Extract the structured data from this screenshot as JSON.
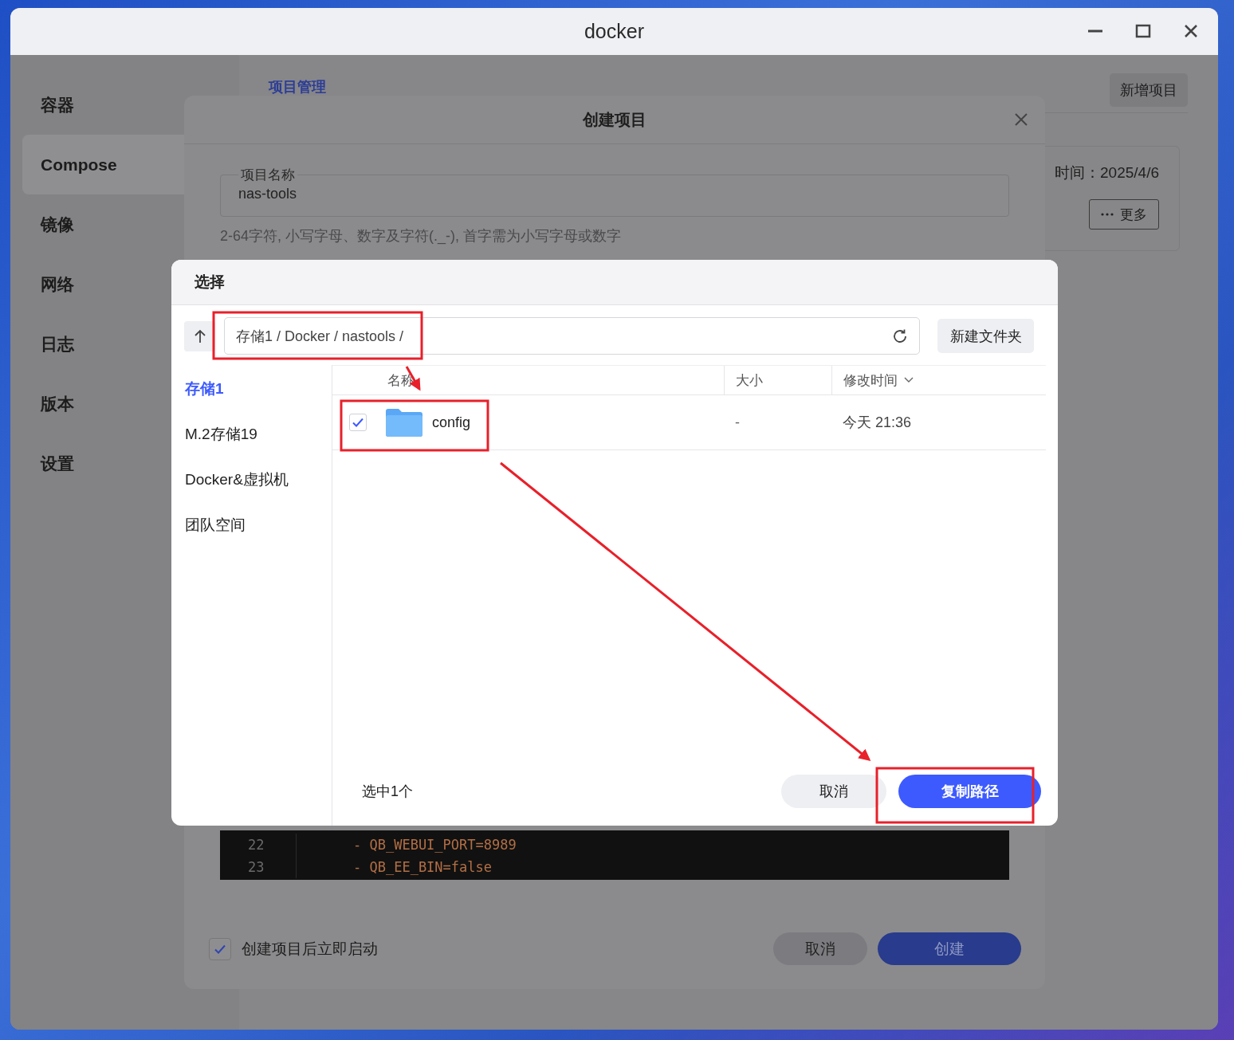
{
  "window": {
    "title": "docker"
  },
  "sidebar": {
    "items": [
      {
        "label": "容器",
        "selected": false
      },
      {
        "label": "Compose",
        "selected": true
      },
      {
        "label": "镜像",
        "selected": false
      },
      {
        "label": "网络",
        "selected": false
      },
      {
        "label": "日志",
        "selected": false
      },
      {
        "label": "版本",
        "selected": false
      },
      {
        "label": "设置",
        "selected": false
      }
    ]
  },
  "main": {
    "breadcrumb": "项目管理",
    "add_button": "新增项目",
    "project_card": {
      "created": "时间：2025/4/6",
      "more_button": "更多"
    }
  },
  "create_dialog": {
    "title": "创建项目",
    "name_field": {
      "label": "项目名称",
      "value": "nas-tools"
    },
    "hint": "2-64字符, 小写字母、数字及字符(._-), 首字需为小写字母或数字",
    "editor": {
      "lines": [
        {
          "number": "22",
          "code": "- QB_WEBUI_PORT=8989"
        },
        {
          "number": "23",
          "code": "- QB_EE_BIN=false"
        }
      ]
    },
    "auto_start": {
      "label": "创建项目后立即启动",
      "checked": true
    },
    "buttons": {
      "cancel": "取消",
      "create": "创建"
    }
  },
  "select_dialog": {
    "title": "选择",
    "path": "存储1 / Docker / nastools /",
    "new_folder_button": "新建文件夹",
    "locations": [
      {
        "label": "存储1",
        "selected": true
      },
      {
        "label": "M.2存储19",
        "selected": false
      },
      {
        "label": "Docker&虚拟机",
        "selected": false
      },
      {
        "label": "团队空间",
        "selected": false
      }
    ],
    "table": {
      "columns": [
        "名称",
        "大小",
        "修改时间"
      ],
      "rows": [
        {
          "name": "config",
          "size": "-",
          "modified": "今天 21:36",
          "checked": true
        }
      ]
    },
    "selection_count": "选中1个",
    "buttons": {
      "cancel": "取消",
      "confirm": "复制路径"
    }
  }
}
